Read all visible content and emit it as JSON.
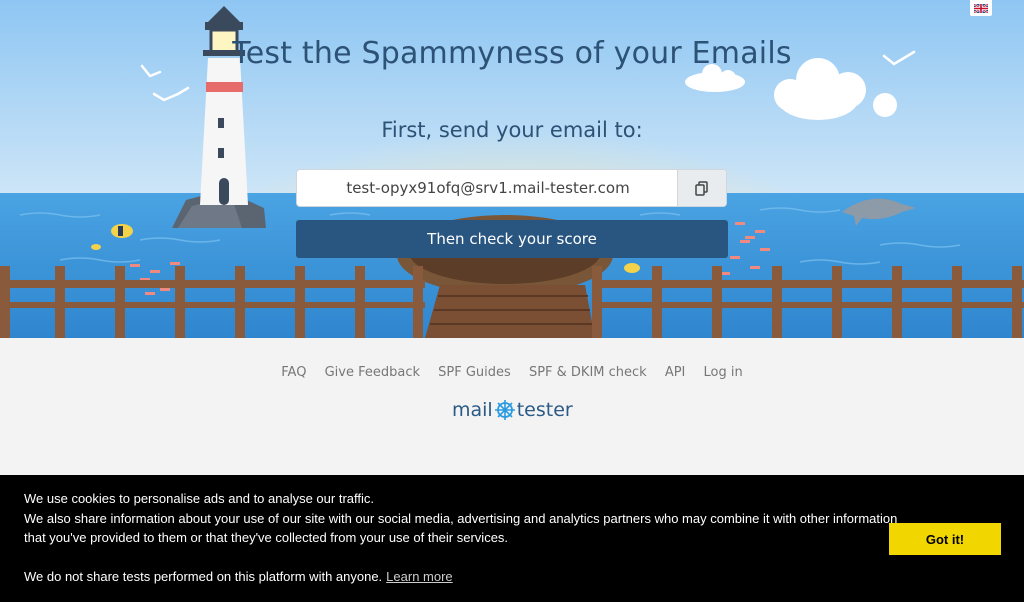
{
  "hero": {
    "title": "Test the Spammyness of your Emails",
    "subtitle": "First, send your email to:",
    "email_address": "test-opyx91ofq@srv1.mail-tester.com",
    "check_button": "Then check your score",
    "copy_icon": "copy-icon",
    "language_icon": "uk-flag-icon"
  },
  "footer": {
    "links": [
      "FAQ",
      "Give Feedback",
      "SPF Guides",
      "SPF & DKIM check",
      "API",
      "Log in"
    ],
    "logo_left": "mail",
    "logo_right": "tester"
  },
  "cookie_banner": {
    "line1": "We use cookies to personalise ads and to analyse our traffic.",
    "line2": "We also share information about your use of our site with our social media, advertising and analytics partners who may combine it with other information that you've provided to them or that they've collected from your use of their services.",
    "line3": "We do not share tests performed on this platform with anyone.",
    "learn_more": "Learn more",
    "accept_button": "Got it!"
  },
  "colors": {
    "sky": "#a9d3f5",
    "sea": "#3c97da",
    "brand": "#285680",
    "accept": "#f1d600"
  }
}
